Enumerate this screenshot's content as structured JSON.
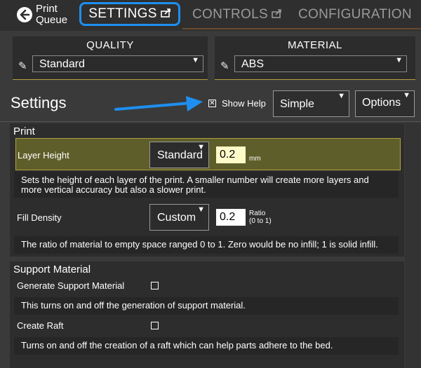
{
  "nav": {
    "back_label_line1": "Print",
    "back_label_line2": "Queue",
    "tabs": [
      {
        "label": "SETTINGS",
        "icon": "popout-icon",
        "active": true
      },
      {
        "label": "CONTROLS",
        "icon": "popout-icon",
        "active": false
      },
      {
        "label": "CONFIGURATION",
        "active": false
      }
    ],
    "active_color": "#1e8ff0"
  },
  "quality": {
    "title": "QUALITY",
    "value": "Standard"
  },
  "material": {
    "title": "MATERIAL",
    "value": "ABS"
  },
  "settings_header": {
    "title": "Settings",
    "show_help_label": "Show Help",
    "show_help_checked": true,
    "mode_select": "Simple",
    "options_label": "Options"
  },
  "print_group": {
    "title": "Print",
    "layer_height": {
      "label": "Layer Height",
      "preset": "Standard",
      "value": "0.2",
      "unit": "mm",
      "help": "Sets the height of each layer of the print. A smaller number will create more layers and more vertical accuracy but also a slower print."
    },
    "fill_density": {
      "label": "Fill Density",
      "preset": "Custom",
      "value": "0.2",
      "unit_line1": "Ratio",
      "unit_line2": "(0 to 1)",
      "help": "The ratio of material to empty space ranged 0 to 1. Zero would be no infill; 1 is solid infill."
    }
  },
  "support_group": {
    "title": "Support Material",
    "generate_support": {
      "label": "Generate Support Material",
      "checked": false,
      "help": "This turns on and off the generation of support material."
    },
    "create_raft": {
      "label": "Create Raft",
      "checked": false,
      "help": "Turns on and off the creation of a raft which can help parts adhere to the bed."
    }
  }
}
